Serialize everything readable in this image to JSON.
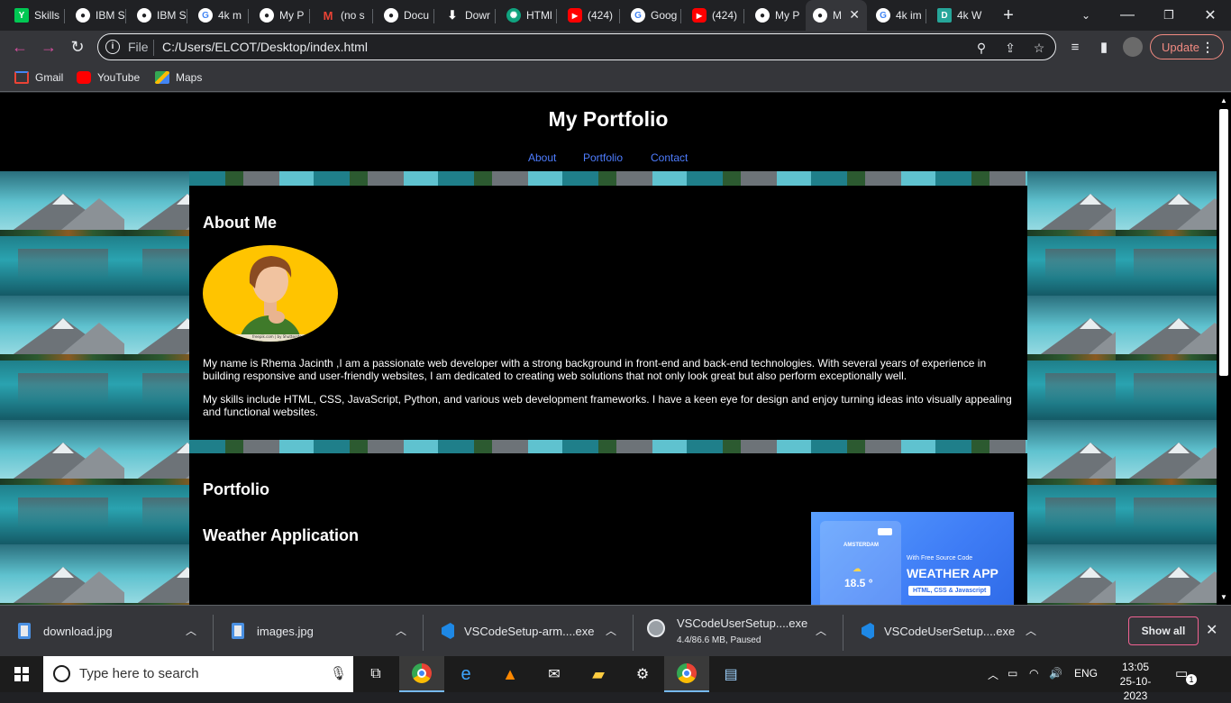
{
  "browser": {
    "tabs": [
      {
        "label": "Skills",
        "icon": "skills-icon",
        "color": "#00c853"
      },
      {
        "label": "IBM S",
        "icon": "globe-icon",
        "color": "#ffffff"
      },
      {
        "label": "IBM S",
        "icon": "globe-icon",
        "color": "#ffffff"
      },
      {
        "label": "4k m",
        "icon": "google-icon",
        "color": "#4285f4"
      },
      {
        "label": "My P",
        "icon": "globe-icon",
        "color": "#ffffff"
      },
      {
        "label": "(no s",
        "icon": "gmail-icon",
        "color": "#ea4335"
      },
      {
        "label": "Docu",
        "icon": "globe-icon",
        "color": "#ffffff"
      },
      {
        "label": "Dowr",
        "icon": "download-icon",
        "color": "#ffffff"
      },
      {
        "label": "HTMl",
        "icon": "chatgpt-icon",
        "color": "#10a37f"
      },
      {
        "label": "(424)",
        "icon": "youtube-icon",
        "color": "#ff0000"
      },
      {
        "label": "Goog",
        "icon": "google-icon",
        "color": "#4285f4"
      },
      {
        "label": "(424)",
        "icon": "youtube-icon",
        "color": "#ff0000"
      },
      {
        "label": "My P",
        "icon": "globe-icon",
        "color": "#ffffff"
      },
      {
        "label": "M",
        "icon": "globe-icon",
        "color": "#ffffff",
        "active": true
      },
      {
        "label": "4k im",
        "icon": "google-icon",
        "color": "#4285f4"
      },
      {
        "label": "4k W",
        "icon": "doc-icon",
        "color": "#26a69a"
      }
    ],
    "new_tab": "+",
    "address": {
      "scheme": "File",
      "url": "C:/Users/ELCOT/Desktop/index.html"
    },
    "update_label": "Update",
    "bookmarks": [
      {
        "label": "Gmail",
        "icon": "gmail-icon"
      },
      {
        "label": "YouTube",
        "icon": "youtube-icon"
      },
      {
        "label": "Maps",
        "icon": "maps-icon"
      }
    ]
  },
  "page": {
    "title": "My Portfolio",
    "nav": [
      "About",
      "Portfolio",
      "Contact"
    ],
    "about": {
      "heading": "About Me",
      "avatar_caption": "freepik.com | by Shutterstock",
      "para1": "My name is Rhema Jacinth ,I am a passionate web developer with a strong background in front-end and back-end technologies. With several years of experience in building responsive and user-friendly websites, I am dedicated to creating web solutions that not only look great but also perform exceptionally well.",
      "para2": "My skills include HTML, CSS, JavaScript, Python, and various web development frameworks. I have a keen eye for design and enjoy turning ideas into visually appealing and functional websites."
    },
    "portfolio": {
      "heading": "Portfolio",
      "project_title": "Weather Application",
      "thumb": {
        "city": "AMSTERDAM",
        "temp": "18.5 °",
        "tagline": "With Free Source Code",
        "headline": "WEATHER APP",
        "badge": "HTML, CSS & Javascript"
      }
    }
  },
  "downloads": {
    "items": [
      {
        "name": "download.jpg",
        "sub": "",
        "icon": "image-file-icon"
      },
      {
        "name": "images.jpg",
        "sub": "",
        "icon": "image-file-icon"
      },
      {
        "name": "VSCodeSetup-arm....exe",
        "sub": "",
        "icon": "vscode-icon"
      },
      {
        "name": "VSCodeUserSetup....exe",
        "sub": "4.4/86.6 MB, Paused",
        "icon": "installer-icon"
      },
      {
        "name": "VSCodeUserSetup....exe",
        "sub": "",
        "icon": "vscode-icon"
      }
    ],
    "show_all": "Show all"
  },
  "taskbar": {
    "search_placeholder": "Type here to search",
    "apps": [
      "chrome-icon",
      "edge-icon",
      "vlc-icon",
      "mail-icon",
      "file-explorer-icon",
      "settings-icon",
      "chrome-profile-icon",
      "notepad-icon"
    ],
    "lang": "ENG",
    "time": "13:05",
    "date": "25-10-2023",
    "notifications": "1"
  },
  "colors": {
    "accent_link": "#4e7dff",
    "chrome_dark": "#35363a",
    "update_red": "#f28b82"
  }
}
